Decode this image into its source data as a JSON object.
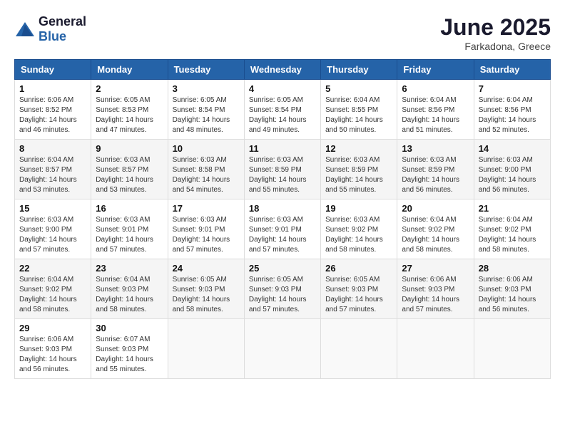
{
  "logo": {
    "general": "General",
    "blue": "Blue"
  },
  "title": {
    "month": "June 2025",
    "location": "Farkadona, Greece"
  },
  "headers": [
    "Sunday",
    "Monday",
    "Tuesday",
    "Wednesday",
    "Thursday",
    "Friday",
    "Saturday"
  ],
  "weeks": [
    [
      {
        "day": "1",
        "sunrise": "6:06 AM",
        "sunset": "8:52 PM",
        "daylight": "14 hours and 46 minutes."
      },
      {
        "day": "2",
        "sunrise": "6:05 AM",
        "sunset": "8:53 PM",
        "daylight": "14 hours and 47 minutes."
      },
      {
        "day": "3",
        "sunrise": "6:05 AM",
        "sunset": "8:54 PM",
        "daylight": "14 hours and 48 minutes."
      },
      {
        "day": "4",
        "sunrise": "6:05 AM",
        "sunset": "8:54 PM",
        "daylight": "14 hours and 49 minutes."
      },
      {
        "day": "5",
        "sunrise": "6:04 AM",
        "sunset": "8:55 PM",
        "daylight": "14 hours and 50 minutes."
      },
      {
        "day": "6",
        "sunrise": "6:04 AM",
        "sunset": "8:56 PM",
        "daylight": "14 hours and 51 minutes."
      },
      {
        "day": "7",
        "sunrise": "6:04 AM",
        "sunset": "8:56 PM",
        "daylight": "14 hours and 52 minutes."
      }
    ],
    [
      {
        "day": "8",
        "sunrise": "6:04 AM",
        "sunset": "8:57 PM",
        "daylight": "14 hours and 53 minutes."
      },
      {
        "day": "9",
        "sunrise": "6:03 AM",
        "sunset": "8:57 PM",
        "daylight": "14 hours and 53 minutes."
      },
      {
        "day": "10",
        "sunrise": "6:03 AM",
        "sunset": "8:58 PM",
        "daylight": "14 hours and 54 minutes."
      },
      {
        "day": "11",
        "sunrise": "6:03 AM",
        "sunset": "8:59 PM",
        "daylight": "14 hours and 55 minutes."
      },
      {
        "day": "12",
        "sunrise": "6:03 AM",
        "sunset": "8:59 PM",
        "daylight": "14 hours and 55 minutes."
      },
      {
        "day": "13",
        "sunrise": "6:03 AM",
        "sunset": "8:59 PM",
        "daylight": "14 hours and 56 minutes."
      },
      {
        "day": "14",
        "sunrise": "6:03 AM",
        "sunset": "9:00 PM",
        "daylight": "14 hours and 56 minutes."
      }
    ],
    [
      {
        "day": "15",
        "sunrise": "6:03 AM",
        "sunset": "9:00 PM",
        "daylight": "14 hours and 57 minutes."
      },
      {
        "day": "16",
        "sunrise": "6:03 AM",
        "sunset": "9:01 PM",
        "daylight": "14 hours and 57 minutes."
      },
      {
        "day": "17",
        "sunrise": "6:03 AM",
        "sunset": "9:01 PM",
        "daylight": "14 hours and 57 minutes."
      },
      {
        "day": "18",
        "sunrise": "6:03 AM",
        "sunset": "9:01 PM",
        "daylight": "14 hours and 57 minutes."
      },
      {
        "day": "19",
        "sunrise": "6:03 AM",
        "sunset": "9:02 PM",
        "daylight": "14 hours and 58 minutes."
      },
      {
        "day": "20",
        "sunrise": "6:04 AM",
        "sunset": "9:02 PM",
        "daylight": "14 hours and 58 minutes."
      },
      {
        "day": "21",
        "sunrise": "6:04 AM",
        "sunset": "9:02 PM",
        "daylight": "14 hours and 58 minutes."
      }
    ],
    [
      {
        "day": "22",
        "sunrise": "6:04 AM",
        "sunset": "9:02 PM",
        "daylight": "14 hours and 58 minutes."
      },
      {
        "day": "23",
        "sunrise": "6:04 AM",
        "sunset": "9:03 PM",
        "daylight": "14 hours and 58 minutes."
      },
      {
        "day": "24",
        "sunrise": "6:05 AM",
        "sunset": "9:03 PM",
        "daylight": "14 hours and 58 minutes."
      },
      {
        "day": "25",
        "sunrise": "6:05 AM",
        "sunset": "9:03 PM",
        "daylight": "14 hours and 57 minutes."
      },
      {
        "day": "26",
        "sunrise": "6:05 AM",
        "sunset": "9:03 PM",
        "daylight": "14 hours and 57 minutes."
      },
      {
        "day": "27",
        "sunrise": "6:06 AM",
        "sunset": "9:03 PM",
        "daylight": "14 hours and 57 minutes."
      },
      {
        "day": "28",
        "sunrise": "6:06 AM",
        "sunset": "9:03 PM",
        "daylight": "14 hours and 56 minutes."
      }
    ],
    [
      {
        "day": "29",
        "sunrise": "6:06 AM",
        "sunset": "9:03 PM",
        "daylight": "14 hours and 56 minutes."
      },
      {
        "day": "30",
        "sunrise": "6:07 AM",
        "sunset": "9:03 PM",
        "daylight": "14 hours and 55 minutes."
      },
      null,
      null,
      null,
      null,
      null
    ]
  ],
  "labels": {
    "sunrise": "Sunrise:",
    "sunset": "Sunset:",
    "daylight": "Daylight:"
  }
}
